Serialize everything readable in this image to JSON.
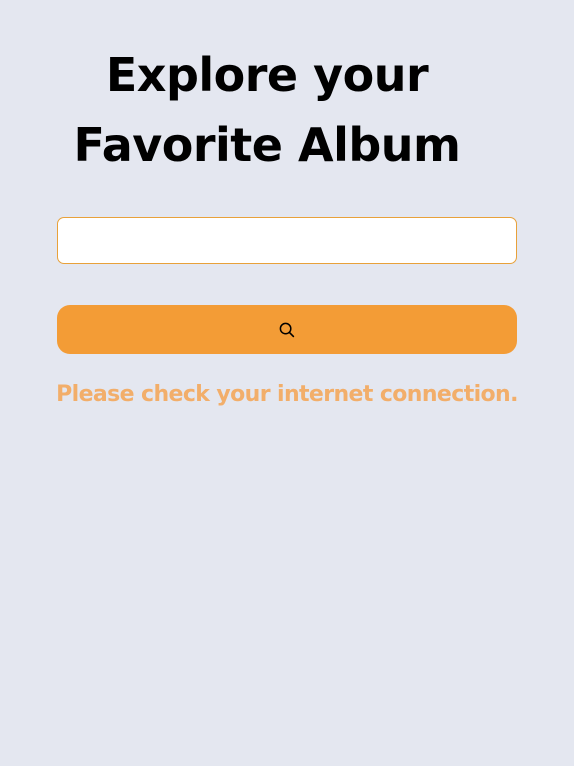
{
  "header": {
    "title_line1": "Explore your",
    "title_line2": "Favorite Album"
  },
  "search": {
    "input_value": "",
    "button_icon": "search-icon"
  },
  "status": {
    "error_message": "Please check your internet connection."
  },
  "colors": {
    "background": "#e4e7f0",
    "accent": "#f39c36",
    "input_border": "#e8a13a",
    "error_text": "#f2ae6a",
    "title_text": "#000000"
  }
}
